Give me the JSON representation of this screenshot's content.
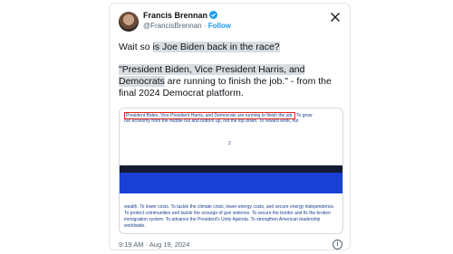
{
  "tweet": {
    "author_name": "Francis Brennan",
    "author_handle": "@FrancisBrennan",
    "separator": " · ",
    "follow_label": "Follow",
    "text_line1_prefix": "Wait so ",
    "text_line1_highlight": "is Joe Biden back in the race?",
    "text_quote_highlight": "\"President Biden, Vice President Harris, and Democrats",
    "text_quote_rest": " are running to finish the job.\" - from the final 2024 Democrat platform.",
    "timestamp": "9:19 AM · Aug 19, 2024",
    "info_icon": "i"
  },
  "embed": {
    "highlight_sentence": "President Biden, Vice President Harris, and Democrats are running to finish the job.",
    "after_highlight": " To grow",
    "line2": "our economy from the middle out and bottom up, not the top down. To reward work, not",
    "page_number": "2",
    "logo_letter": "D",
    "bottom_text": "wealth. To lower costs. To tackle the climate crisis, lower energy costs, and secure energy independence. To protect communities and tackle the scourge of gun violence. To secure the border and fix the broken immigration system. To advance the President's Unity Agenda. To strengthen American leadership worldwide."
  },
  "colors": {
    "accent": "#1d9bf0",
    "highlight_bg": "#d8dde1",
    "party_blue": "#1a3fd6",
    "redbox": "#e0251b"
  },
  "icons": {
    "verified": "verified-badge-icon",
    "x_logo": "x-logo-icon"
  }
}
